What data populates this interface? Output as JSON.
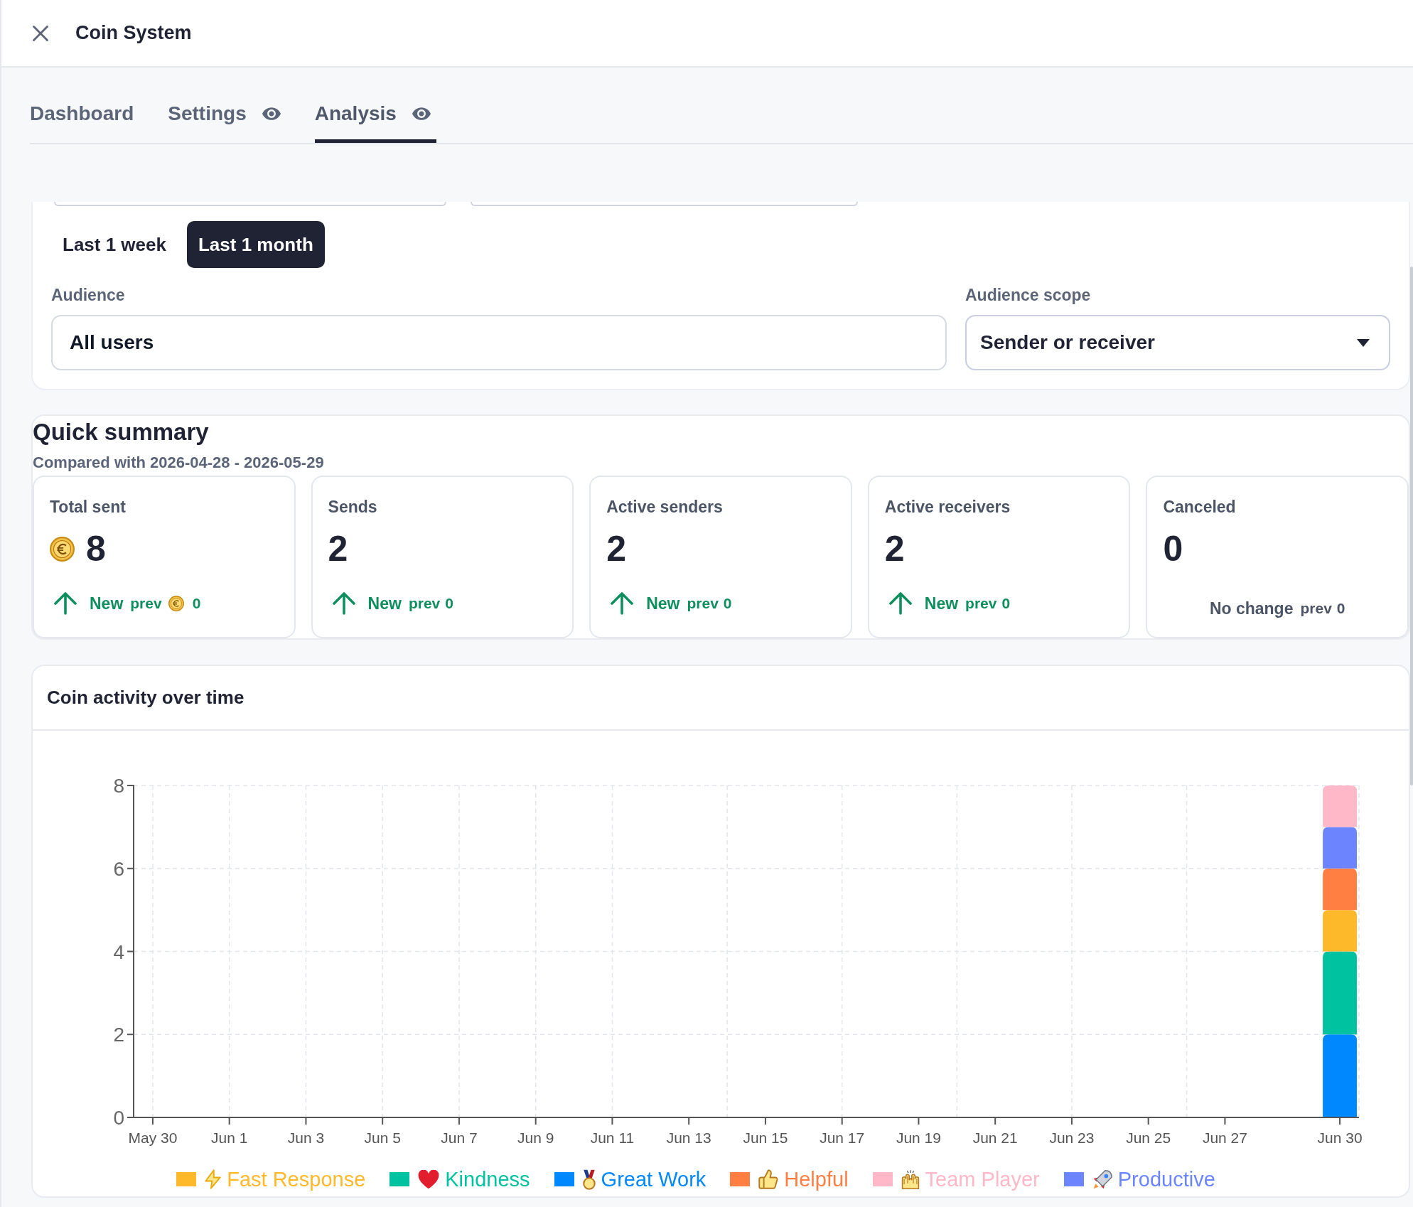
{
  "panel": {
    "title": "Coin System"
  },
  "tabs": [
    {
      "label": "Dashboard",
      "selected": false,
      "indicator": false
    },
    {
      "label": "Settings",
      "selected": false,
      "indicator": true
    },
    {
      "label": "Analysis",
      "selected": true,
      "indicator": true
    }
  ],
  "filters": {
    "time_range": [
      {
        "label": "Last 1 week",
        "selected": false
      },
      {
        "label": "Last 1 month",
        "selected": true
      }
    ],
    "audience": {
      "label": "Audience",
      "value": "All users"
    },
    "audience_scope": {
      "label": "Audience scope",
      "value": "Sender or receiver"
    }
  },
  "quick_summary": {
    "title": "Quick summary",
    "subtitle": "Compared with 2026-04-28 - 2026-05-29",
    "stats": [
      {
        "label": "Total sent",
        "value": "8",
        "coin": true,
        "rising": true,
        "change": "New",
        "prev_label": "prev",
        "prev_value": "0"
      },
      {
        "label": "Sends",
        "value": "2",
        "coin": false,
        "rising": true,
        "change": "New",
        "prev_label": "prev",
        "prev_value": "0"
      },
      {
        "label": "Active senders",
        "value": "2",
        "coin": false,
        "rising": true,
        "change": "New",
        "prev_label": "prev",
        "prev_value": "0"
      },
      {
        "label": "Active receivers",
        "value": "2",
        "coin": false,
        "rising": true,
        "change": "New",
        "prev_label": "prev",
        "prev_value": "0"
      },
      {
        "label": "Canceled",
        "value": "0",
        "coin": false,
        "rising": false,
        "change": "No change",
        "prev_label": "prev",
        "prev_value": "0"
      }
    ]
  },
  "activity_chart": {
    "title": "Coin activity over time",
    "chart_data": {
      "type": "bar",
      "stacked": true,
      "grid": true,
      "legend": true,
      "categories": [
        "May 30",
        null,
        "Jun 1",
        null,
        "Jun 3",
        null,
        "Jun 5",
        null,
        "Jun 7",
        null,
        "Jun 9",
        null,
        "Jun 11",
        null,
        "Jun 13",
        null,
        "Jun 15",
        null,
        "Jun 17",
        null,
        "Jun 19",
        null,
        "Jun 21",
        null,
        "Jun 23",
        null,
        "Jun 25",
        null,
        "Jun 27",
        null,
        null,
        "Jun 30"
      ],
      "ylim": [
        0,
        8
      ],
      "yticks": [
        {
          "value": 0,
          "label": "0"
        },
        {
          "value": 2,
          "label": "2"
        },
        {
          "value": 4,
          "label": "4"
        },
        {
          "value": 6,
          "label": "6"
        },
        {
          "value": 8,
          "label": "8"
        }
      ],
      "series": [
        {
          "name": "Great Work",
          "color": "#0088ff",
          "values": [
            0,
            0,
            0,
            0,
            0,
            0,
            0,
            0,
            0,
            0,
            0,
            0,
            0,
            0,
            0,
            0,
            0,
            0,
            0,
            0,
            0,
            0,
            0,
            0,
            0,
            0,
            0,
            0,
            0,
            0,
            0,
            2
          ]
        },
        {
          "name": "Kindness",
          "color": "#00c2a0",
          "values": [
            0,
            0,
            0,
            0,
            0,
            0,
            0,
            0,
            0,
            0,
            0,
            0,
            0,
            0,
            0,
            0,
            0,
            0,
            0,
            0,
            0,
            0,
            0,
            0,
            0,
            0,
            0,
            0,
            0,
            0,
            0,
            2
          ]
        },
        {
          "name": "Fast Response",
          "color": "#fdb92a",
          "values": [
            0,
            0,
            0,
            0,
            0,
            0,
            0,
            0,
            0,
            0,
            0,
            0,
            0,
            0,
            0,
            0,
            0,
            0,
            0,
            0,
            0,
            0,
            0,
            0,
            0,
            0,
            0,
            0,
            0,
            0,
            0,
            1
          ]
        },
        {
          "name": "Helpful",
          "color": "#ff7f43",
          "values": [
            0,
            0,
            0,
            0,
            0,
            0,
            0,
            0,
            0,
            0,
            0,
            0,
            0,
            0,
            0,
            0,
            0,
            0,
            0,
            0,
            0,
            0,
            0,
            0,
            0,
            0,
            0,
            0,
            0,
            0,
            0,
            1
          ]
        },
        {
          "name": "Productive",
          "color": "#6c85ff",
          "values": [
            0,
            0,
            0,
            0,
            0,
            0,
            0,
            0,
            0,
            0,
            0,
            0,
            0,
            0,
            0,
            0,
            0,
            0,
            0,
            0,
            0,
            0,
            0,
            0,
            0,
            0,
            0,
            0,
            0,
            0,
            0,
            1
          ]
        },
        {
          "name": "Team Player",
          "color": "#ffb8c8",
          "values": [
            0,
            0,
            0,
            0,
            0,
            0,
            0,
            0,
            0,
            0,
            0,
            0,
            0,
            0,
            0,
            0,
            0,
            0,
            0,
            0,
            0,
            0,
            0,
            0,
            0,
            0,
            0,
            0,
            0,
            0,
            0,
            1
          ]
        }
      ]
    }
  }
}
